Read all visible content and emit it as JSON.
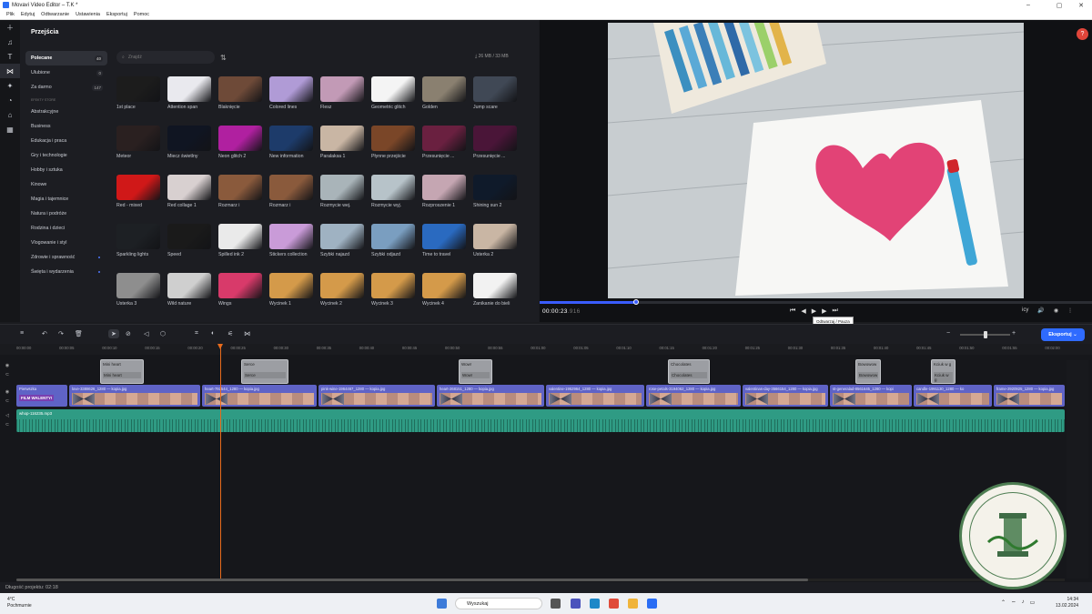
{
  "window": {
    "title": "Movavi Video Editor – T.K *",
    "min": "–",
    "max": "▢",
    "close": "✕"
  },
  "menu": [
    "Plik",
    "Edytuj",
    "Odtwarzanie",
    "Ustawienia",
    "Eksportuj",
    "Pomoc"
  ],
  "rail_icons": [
    "plus-icon",
    "music-icon",
    "text-icon",
    "transitions-icon",
    "magic-icon",
    "stickers-icon",
    "filters-icon",
    "more-icon"
  ],
  "panel": {
    "title": "Przejścia",
    "categories_top": [
      {
        "label": "Polecane",
        "count": "40"
      },
      {
        "label": "Ulubione",
        "count": "0"
      },
      {
        "label": "Za darmo",
        "count": "147"
      }
    ],
    "section_header": "EFEKTY STORE",
    "categories": [
      "Abstrakcyjne",
      "Business",
      "Edukacja i praca",
      "Gry i technologie",
      "Hobby i sztuka",
      "Kinowe",
      "Magia i tajemnice",
      "Natura i podróże",
      "Rodzina i dzieci",
      "Vlogowanie i styl",
      "Zdrowie i sprawność",
      "Święta i wydarzenia"
    ],
    "categories_dot": [
      false,
      false,
      false,
      false,
      false,
      false,
      false,
      false,
      false,
      false,
      true,
      true
    ],
    "search_placeholder": "Znajdź",
    "size_info": "26 MB / 33 MB",
    "transitions": [
      "1st place",
      "Attention span",
      "Blaknięcie",
      "Colored lines",
      "Flesz",
      "Geometric glitch",
      "Golden",
      "Jump scare",
      "Meteor",
      "Miecz świetlny",
      "Neon glitch 2",
      "New information",
      "Paralaksa 1",
      "Płynne przejście",
      "Przesunięcie ...",
      "Przesunięcie ...",
      "Red - mixed",
      "Red collage 1",
      "Rozmarz i",
      "Rozmarz i",
      "Rozmycie wej.",
      "Rozmycie wyj.",
      "Rozproszenie 1",
      "Shining sun 2",
      "Sparkling lights",
      "Speed",
      "Spilled ink 2",
      "Stickers collection",
      "Szybki najazd",
      "Szybki odjazd",
      "Time to travel",
      "Usterka 2",
      "Usterka 3",
      "Wild nature",
      "Wings",
      "Wycinek 1",
      "Wycinek 2",
      "Wycinek 3",
      "Wycinek 4",
      "Zanikanie do bieli"
    ],
    "thumb_colors": [
      "#1c1c1c",
      "#e9e9ee",
      "#6e4a38",
      "#b09bd6",
      "#c29ab6",
      "#f4f4f4",
      "#8a8070",
      "#404855",
      "#2a2020",
      "#101522",
      "#b020a0",
      "#1d3b6a",
      "#c9b6a4",
      "#7a4628",
      "#6a2040",
      "#4a1538",
      "#d01818",
      "#d8d0d0",
      "#8a5a3c",
      "#8a5a3c",
      "#a9b4b9",
      "#b7c3c9",
      "#c5a6b2",
      "#0f1a2a",
      "#1d2024",
      "#1a1a1a",
      "#eaeaea",
      "#c99bd8",
      "#9fb2c2",
      "#7a9ec0",
      "#2a6ac0",
      "#c9b6a4",
      "#8e8e8e",
      "#cfcfcf",
      "#d83a6a",
      "#d49a4a",
      "#d49a4a",
      "#d49a4a",
      "#d49a4a",
      "#f2f2f2"
    ],
    "golden_free": true
  },
  "preview": {
    "timecode": "00:00:23",
    "timecode_frac": ".916",
    "tooltip_line1": "Odtwarzaj / Pauza",
    "tooltip_line2": "(Spacja)",
    "help": "?",
    "right_ctrl": "icy",
    "seek_progress": 0.175
  },
  "toolbar": {
    "export_label": "Eksportuj"
  },
  "ruler": [
    "00:00:00",
    "00:00:05",
    "00:00:10",
    "00:00:15",
    "00:00:20",
    "00:00:25",
    "00:00:30",
    "00:00:35",
    "00:00:40",
    "00:00:45",
    "00:00:50",
    "00:00:55",
    "00:01:00",
    "00:01:05",
    "00:01:10",
    "00:01:15",
    "00:01:20",
    "00:01:25",
    "00:01:30",
    "00:01:35",
    "00:01:40",
    "00:01:45",
    "00:01:50",
    "00:01:55",
    "00:02:00"
  ],
  "titles": [
    {
      "a": "Mini heart",
      "b": "Mini heart"
    },
    {
      "a": "Serce",
      "b": "Serce"
    },
    {
      "a": "Wow!",
      "b": "Wow!"
    },
    {
      "a": "Chocolates",
      "b": "Chocolates"
    },
    {
      "a": "Bowowow",
      "b": "Bowowow"
    },
    {
      "a": "Kciuk w g",
      "b": "Kciuk w g"
    }
  ],
  "clips": [
    {
      "name": "Pierwszka",
      "sub": "FILM WALENTY!"
    },
    {
      "name": "love-3388626_1280 — kopia.jpg"
    },
    {
      "name": "heart-792544_1280 — kopia.jpg"
    },
    {
      "name": "pink-wine-1964467_1280 — kopia.jpg"
    },
    {
      "name": "heart-268151_1280 — kopia.jpg"
    },
    {
      "name": "valentine-1952964_1280 — kopia.jpg"
    },
    {
      "name": "rose-petals-3194062_1280 — kopia.jpg"
    },
    {
      "name": "valentinas-day-3566154_1280 — kopia.jpg"
    },
    {
      "name": "st-generalad-8561645_1280 — kopi"
    },
    {
      "name": "candle-1991130_1280 — ko"
    },
    {
      "name": "frame-2920925_1280 — kopia.jpg"
    }
  ],
  "audio": {
    "name": "whop-116235.mp3"
  },
  "status": "Długość projektu: 02:18",
  "taskbar": {
    "temp": "4°C",
    "weather": "Pochmurnie",
    "search": "Wyszukaj",
    "time": "14:34",
    "date": "13.02.2024"
  },
  "stamp_text": "GMINNY OŚRODEK KULTURY W STAWICZCE"
}
